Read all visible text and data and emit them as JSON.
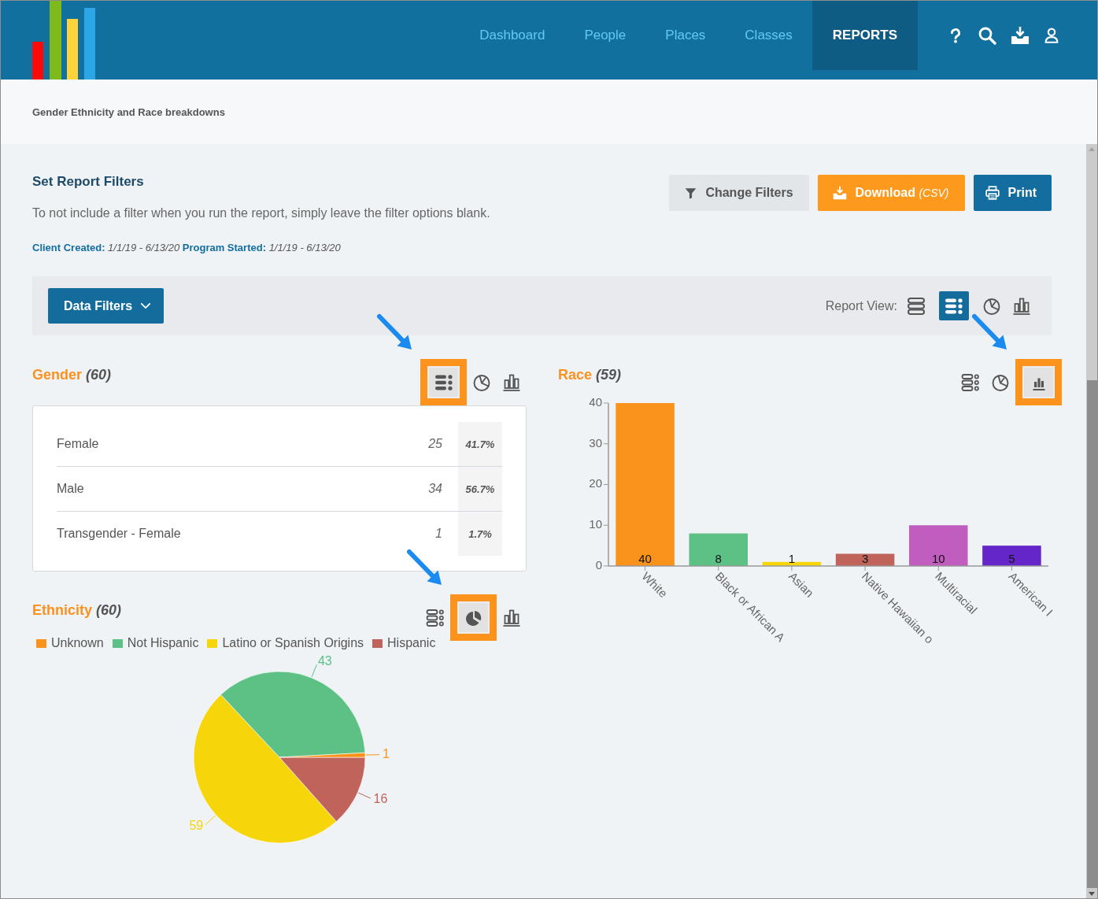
{
  "header": {
    "nav": [
      {
        "label": "Dashboard",
        "selected": false
      },
      {
        "label": "People",
        "selected": false
      },
      {
        "label": "Places",
        "selected": false
      },
      {
        "label": "Classes",
        "selected": false
      },
      {
        "label": "REPORTS",
        "selected": true
      }
    ]
  },
  "breadcrumb": "Gender Ethnicity and Race breakdowns",
  "report_filters": {
    "title": "Set Report Filters",
    "description": "To not include a filter when you run the report, simply leave the filter options blank.",
    "summary": "**Client Created:** *1/1/19 - 6/13/20* **Program Started:** *1/1/19 - 6/13/20*",
    "buttons": [
      {
        "kind": "filter",
        "label": "Change Filters"
      },
      {
        "kind": "download",
        "label": "Download *(CSV)*"
      },
      {
        "kind": "print",
        "label": "Print"
      }
    ]
  },
  "filter_bar": {
    "button": "Data Filters",
    "view_label": "Report View:",
    "views": [
      {
        "kind": "rows",
        "selected": false
      },
      {
        "kind": "list",
        "selected": true
      },
      {
        "kind": "pie",
        "selected": false
      },
      {
        "kind": "bar",
        "selected": false
      }
    ]
  },
  "columns": [
    {
      "panels": [
        {
          "title": "Gender",
          "count": "(60)",
          "views": [
            {
              "kind": "list",
              "selected": true
            },
            {
              "kind": "pie",
              "selected": false
            },
            {
              "kind": "bar",
              "selected": false
            }
          ],
          "rows": [
            {
              "label": "Female",
              "count": "25",
              "percent": "41.7%"
            },
            {
              "label": "Male",
              "count": "34",
              "percent": "56.7%"
            },
            {
              "label": "Transgender - Female",
              "count": "1",
              "percent": "1.7%"
            }
          ]
        },
        {
          "title": "Ethnicity",
          "count": "(60)",
          "views": [
            {
              "kind": "list",
              "selected": false
            },
            {
              "kind": "pie",
              "selected": true
            },
            {
              "kind": "bar",
              "selected": false
            }
          ],
          "legend": [
            {
              "label": "Unknown",
              "color": "#fa931b"
            },
            {
              "label": "Not Hispanic",
              "color": "#5dc186"
            },
            {
              "label": "Latino or Spanish Origins",
              "color": "#f6d50a"
            },
            {
              "label": "Hispanic",
              "color": "#c0635b"
            }
          ],
          "chart_data": {
            "type": "pie",
            "series": [
              {
                "values": [
                  1,
                  43,
                  59,
                  16
                ]
              }
            ],
            "data_labels": true
          }
        }
      ]
    },
    {
      "panels": [
        {
          "title": "Race",
          "count": "(59)",
          "views": [
            {
              "kind": "list",
              "selected": false
            },
            {
              "kind": "pie",
              "selected": false
            },
            {
              "kind": "bar",
              "selected": true
            }
          ],
          "chart_data": {
            "type": "bar",
            "series": [
              {
                "name": "White",
                "color": "#fa931b",
                "values": [
                  40
                ]
              },
              {
                "name": "Black or African A",
                "color": "#5dc186",
                "values": [
                  8
                ]
              },
              {
                "name": "Asian",
                "color": "#f6d50a",
                "values": [
                  1
                ]
              },
              {
                "name": "Native Hawaiian o",
                "color": "#c0635b",
                "values": [
                  3
                ]
              },
              {
                "name": "Multiracial",
                "color": "#c05dbf",
                "values": [
                  10
                ]
              },
              {
                "name": "American I",
                "color": "#6426c9",
                "values": [
                  5
                ]
              }
            ],
            "ylim": [
              0,
              40
            ],
            "yticks": [
              0,
              10,
              20,
              30,
              40
            ],
            "data_labels": true
          }
        }
      ]
    }
  ]
}
